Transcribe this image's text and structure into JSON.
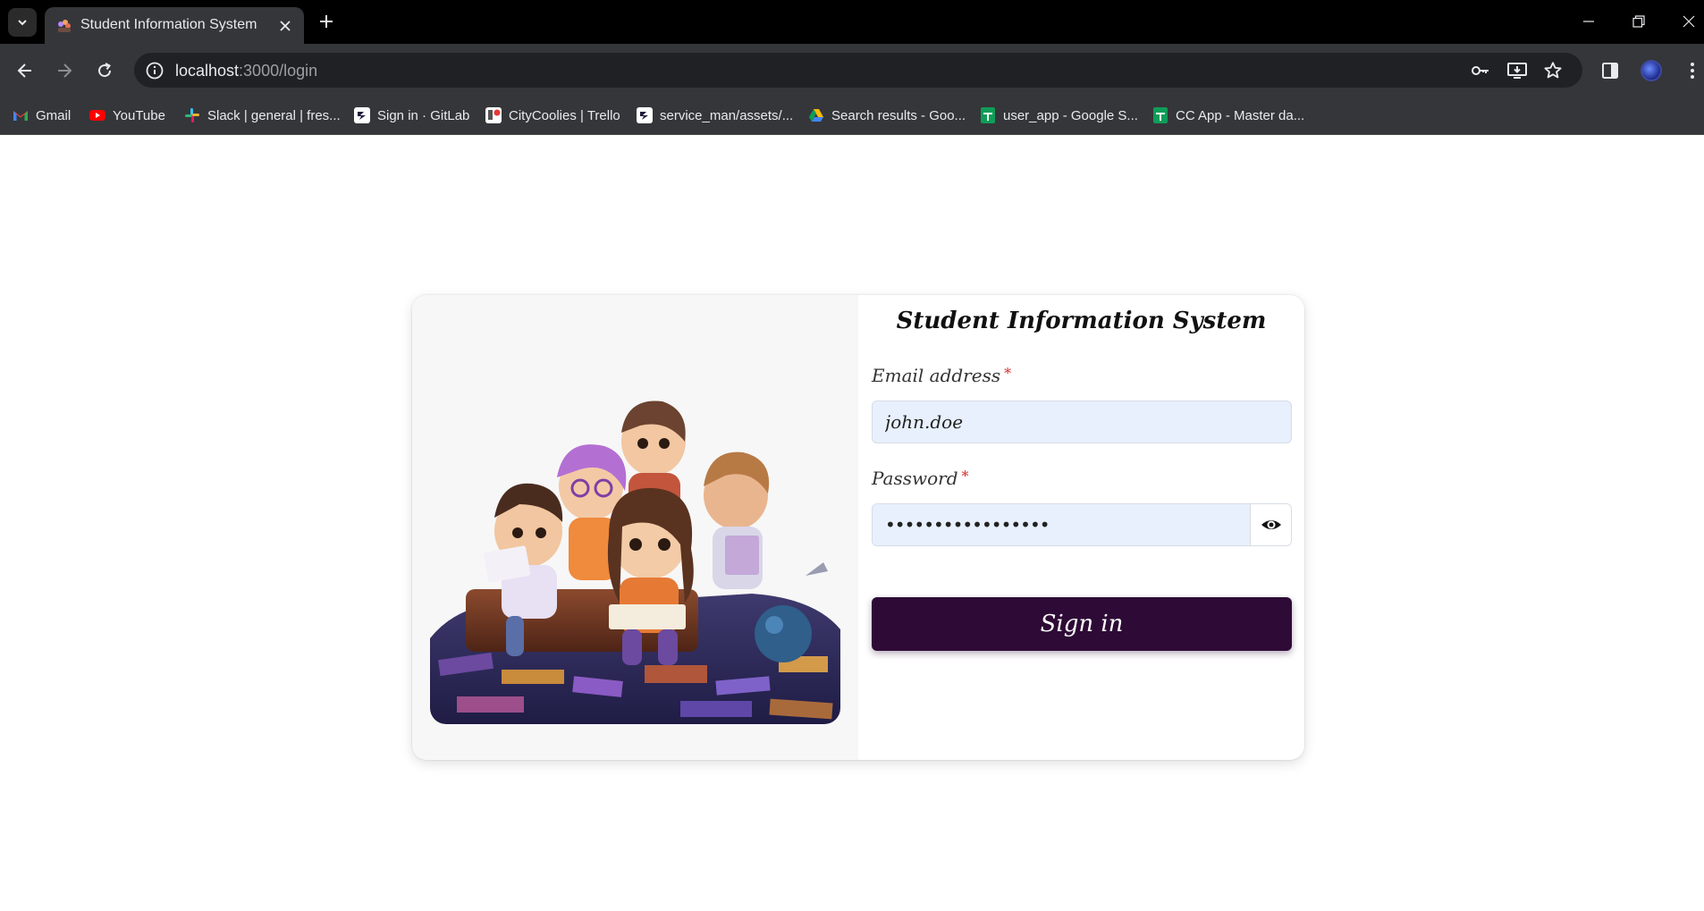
{
  "browser": {
    "tab_title": "Student Information System",
    "url_host": "localhost",
    "url_path": ":3000/login",
    "bookmarks": [
      {
        "label": "Gmail",
        "icon": "gmail-icon",
        "color": "#ea4335"
      },
      {
        "label": "YouTube",
        "icon": "youtube-icon",
        "color": "#ff0000"
      },
      {
        "label": "Slack | general | fres...",
        "icon": "slack-icon",
        "color": "#e01e5a"
      },
      {
        "label": "Sign in · GitLab",
        "icon": "gitlab-icon",
        "color": "#ffffff"
      },
      {
        "label": "CityCoolies | Trello",
        "icon": "trello-icon",
        "color": "#ffffff"
      },
      {
        "label": "service_man/assets/...",
        "icon": "file-icon",
        "color": "#ffffff"
      },
      {
        "label": "Search results - Goo...",
        "icon": "google-drive-icon",
        "color": "#fbbc04"
      },
      {
        "label": "user_app - Google S...",
        "icon": "google-sheets-icon",
        "color": "#0f9d58"
      },
      {
        "label": "CC App - Master da...",
        "icon": "google-sheets-icon",
        "color": "#0f9d58"
      }
    ]
  },
  "login": {
    "title": "Student Information System",
    "email_label": "Email address",
    "email_value": "john.doe",
    "password_label": "Password",
    "password_mask": "•••••••••••••••••",
    "required_marker": "*",
    "signin_label": "Sign in"
  },
  "colors": {
    "accent": "#2e0b36",
    "input_bg": "#e8f0fe",
    "required": "#d32f2f"
  }
}
